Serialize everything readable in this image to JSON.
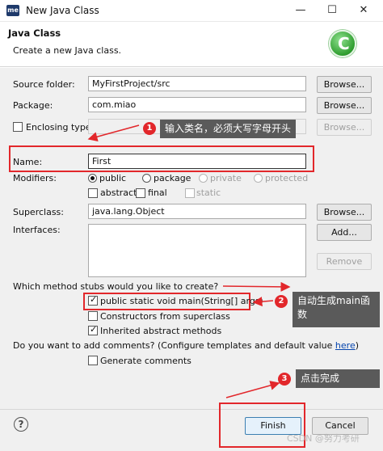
{
  "window": {
    "app_icon": "me",
    "title": "New Java Class",
    "minimize": "—",
    "maximize": "☐",
    "close": "✕"
  },
  "header": {
    "title": "Java Class",
    "subtitle": "Create a new Java class."
  },
  "form": {
    "source_folder": {
      "label": "Source folder:",
      "value": "MyFirstProject/src",
      "browse": "Browse..."
    },
    "package": {
      "label": "Package:",
      "value": "com.miao",
      "browse": "Browse..."
    },
    "enclosing": {
      "label": "Enclosing type:",
      "value": "",
      "browse": "Browse..."
    },
    "name": {
      "label": "Name:",
      "value": "First"
    },
    "modifiers": {
      "label": "Modifiers:",
      "public": "public",
      "package": "package",
      "private": "private",
      "protected": "protected",
      "abstract": "abstract",
      "final": "final",
      "static": "static"
    },
    "superclass": {
      "label": "Superclass:",
      "value": "java.lang.Object",
      "browse": "Browse..."
    },
    "interfaces": {
      "label": "Interfaces:",
      "add": "Add...",
      "remove": "Remove"
    },
    "stubs": {
      "question": "Which method stubs would you like to create?",
      "main": "public static void main(String[] args)",
      "constructors": "Constructors from superclass",
      "inherited": "Inherited abstract methods"
    },
    "comments": {
      "question": "Do you want to add comments? (Configure templates and default value ",
      "here": "here",
      "close_paren": ")",
      "generate": "Generate comments"
    }
  },
  "footer": {
    "help": "?",
    "finish": "Finish",
    "cancel": "Cancel"
  },
  "annotations": {
    "a1": {
      "num": "1",
      "text": "输入类名，必须大写字母开头"
    },
    "a2": {
      "num": "2",
      "line1": "自动生成main函",
      "line2": "数"
    },
    "a3": {
      "num": "3",
      "text": "点击完成"
    }
  },
  "watermark": "CSDN @努力考研",
  "colors": {
    "annotation_red": "#e2272b",
    "callout_bg": "#5a5a5a",
    "link": "#0645ad"
  }
}
